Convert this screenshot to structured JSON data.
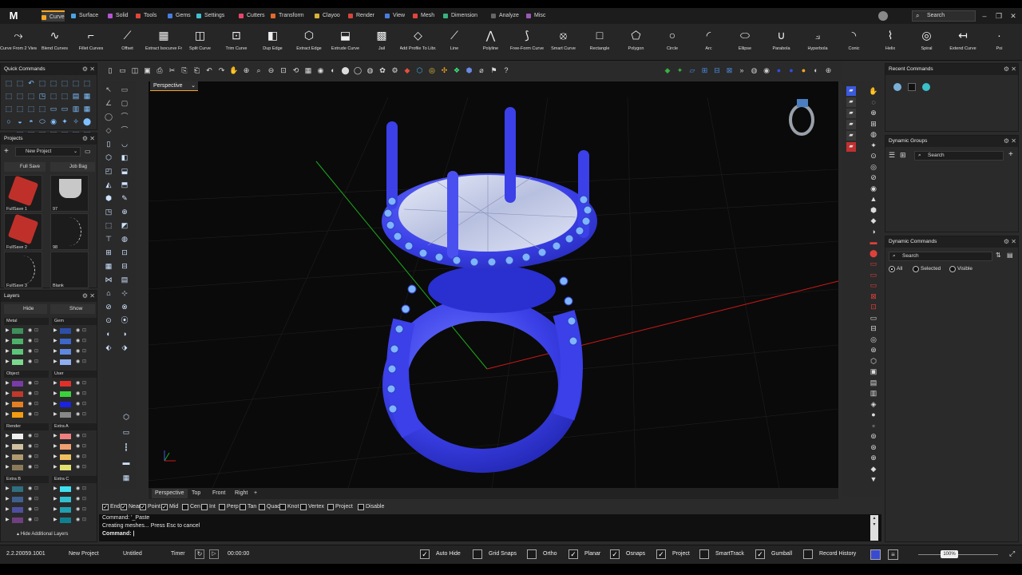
{
  "app": {
    "logo": "M",
    "search_placeholder": "Search"
  },
  "tabs": [
    {
      "label": "Curve",
      "color": "#f5a623"
    },
    {
      "label": "Surface",
      "color": "#4aa3df"
    },
    {
      "label": "Solid",
      "color": "#b455d6"
    },
    {
      "label": "Tools",
      "color": "#e0453a"
    },
    {
      "label": "Gems",
      "color": "#4a7be0"
    },
    {
      "label": "Settings",
      "color": "#3ec1d3"
    },
    {
      "label": "Cutters",
      "color": "#e8456a"
    },
    {
      "label": "Transform",
      "color": "#e06a2c"
    },
    {
      "label": "Clayoo",
      "color": "#d6b13c"
    },
    {
      "label": "Render",
      "color": "#d6453a"
    },
    {
      "label": "View",
      "color": "#4a7be0"
    },
    {
      "label": "Mesh",
      "color": "#e0453a"
    },
    {
      "label": "Dimension",
      "color": "#36b37e"
    },
    {
      "label": "Analyze",
      "color": "#666666"
    },
    {
      "label": "Misc",
      "color": "#9b59b6"
    }
  ],
  "ribbon": [
    {
      "label": "Curve From 2 Views",
      "icon": "curve-from-views-icon",
      "glyph": "⤳"
    },
    {
      "label": "Blend Curves",
      "icon": "blend-curves-icon",
      "glyph": "∿"
    },
    {
      "label": "Fillet Curves",
      "icon": "fillet-curves-icon",
      "glyph": "⌐"
    },
    {
      "label": "Offset",
      "icon": "offset-icon",
      "glyph": "⟋"
    },
    {
      "label": "Extract Isocurve Fr...",
      "icon": "extract-isocurve-icon",
      "glyph": "▦"
    },
    {
      "label": "Split Curve",
      "icon": "split-curve-icon",
      "glyph": "◫"
    },
    {
      "label": "Trim Curve",
      "icon": "trim-curve-icon",
      "glyph": "⊡"
    },
    {
      "label": "Dup Edge",
      "icon": "dup-edge-icon",
      "glyph": "◧"
    },
    {
      "label": "Extract Edge",
      "icon": "extract-edge-icon",
      "glyph": "⬡"
    },
    {
      "label": "Extrude Curve",
      "icon": "extrude-curve-icon",
      "glyph": "⬓"
    },
    {
      "label": "Jail",
      "icon": "jail-icon",
      "glyph": "▩"
    },
    {
      "label": "Add Profile To Libr...",
      "icon": "add-profile-icon",
      "glyph": "◇"
    },
    {
      "label": "Line",
      "icon": "line-icon",
      "glyph": "⟋"
    },
    {
      "label": "Polyline",
      "icon": "polyline-icon",
      "glyph": "⋀"
    },
    {
      "label": "Free-Form Curve",
      "icon": "freeform-curve-icon",
      "glyph": "⟆"
    },
    {
      "label": "Smart Curve",
      "icon": "smart-curve-icon",
      "glyph": "⦻"
    },
    {
      "label": "Rectangle",
      "icon": "rectangle-icon",
      "glyph": "□"
    },
    {
      "label": "Polygon",
      "icon": "polygon-icon",
      "glyph": "⬠"
    },
    {
      "label": "Circle",
      "icon": "circle-icon",
      "glyph": "○"
    },
    {
      "label": "Arc",
      "icon": "arc-icon",
      "glyph": "◜"
    },
    {
      "label": "Ellipse",
      "icon": "ellipse-icon",
      "glyph": "⬭"
    },
    {
      "label": "Parabola",
      "icon": "parabola-icon",
      "glyph": "∪"
    },
    {
      "label": "Hyperbola",
      "icon": "hyperbola-icon",
      "glyph": "⟓"
    },
    {
      "label": "Conic",
      "icon": "conic-icon",
      "glyph": "◝"
    },
    {
      "label": "Helix",
      "icon": "helix-icon",
      "glyph": "⌇"
    },
    {
      "label": "Spiral",
      "icon": "spiral-icon",
      "glyph": "◎"
    },
    {
      "label": "Extend Curve",
      "icon": "extend-curve-icon",
      "glyph": "↤"
    },
    {
      "label": "Poi",
      "icon": "point-icon",
      "glyph": "·"
    }
  ],
  "quick_commands": {
    "title": "Quick Commands"
  },
  "projects": {
    "title": "Projects",
    "new_project": "New Project",
    "full_save": "Full Save",
    "job_bag": "Job Bag",
    "items": [
      {
        "label": "FullSave 1"
      },
      {
        "label": "97"
      },
      {
        "label": "FullSave 2"
      },
      {
        "label": "98"
      },
      {
        "label": "FullSave 3"
      },
      {
        "label": "Blank"
      }
    ]
  },
  "layers": {
    "title": "Layers",
    "hide": "Hide",
    "show": "Show",
    "hide_additional": "Hide Additional Layers",
    "groups": [
      {
        "name": "Metal",
        "colors": [
          "#3f8f5a",
          "#4db06b",
          "#5cc57a",
          "#7bd88f"
        ]
      },
      {
        "name": "Gem",
        "colors": [
          "#2d4fa8",
          "#3d67c8",
          "#5f88e0",
          "#8fb0f0"
        ]
      },
      {
        "name": "Object",
        "colors": [
          "#7a3aa8",
          "#c0392b",
          "#e67e22",
          "#f39c12"
        ]
      },
      {
        "name": "User",
        "colors": [
          "#e0302a",
          "#3bd13b",
          "#1b22e0",
          "#888888"
        ]
      },
      {
        "name": "Render",
        "colors": [
          "#f0f0f0",
          "#cfc0a0",
          "#b09a70",
          "#8a7a5a"
        ]
      },
      {
        "name": "Extra A",
        "colors": [
          "#f08080",
          "#f0a070",
          "#f0c060",
          "#e0e070"
        ]
      },
      {
        "name": "Extra B",
        "colors": [
          "#2f6f7f",
          "#3f5f8f",
          "#4f4f9f",
          "#6f3f7f"
        ]
      },
      {
        "name": "Extra C",
        "colors": [
          "#40e0f0",
          "#30c0d0",
          "#20a0b0",
          "#108090"
        ]
      }
    ]
  },
  "viewport": {
    "label": "Perspective",
    "tabs": [
      "Perspective",
      "Top",
      "Front",
      "Right"
    ],
    "add_tab": "+"
  },
  "snaps": [
    {
      "label": "End",
      "checked": true
    },
    {
      "label": "Near",
      "checked": true
    },
    {
      "label": "Point",
      "checked": true
    },
    {
      "label": "Mid",
      "checked": true
    },
    {
      "label": "Cen",
      "checked": false
    },
    {
      "label": "Int",
      "checked": false
    },
    {
      "label": "Perp",
      "checked": false
    },
    {
      "label": "Tan",
      "checked": false
    },
    {
      "label": "Quad",
      "checked": false
    },
    {
      "label": "Knot",
      "checked": false
    },
    {
      "label": "Vertex",
      "checked": false
    },
    {
      "label": "Project",
      "checked": false
    },
    {
      "label": "Disable",
      "checked": false
    }
  ],
  "command": {
    "line1": "Command: '_Paste",
    "line2": "Creating meshes... Press Esc to cancel",
    "prompt": "Command:"
  },
  "status": {
    "version": "2.2.20059.1001",
    "project": "New Project",
    "file": "Untitled",
    "timer_label": "Timer",
    "timer": "00:00:00",
    "toggles": [
      {
        "label": "Auto Hide",
        "checked": true
      },
      {
        "label": "Grid Snaps",
        "checked": false
      },
      {
        "label": "Ortho",
        "checked": false
      },
      {
        "label": "Planar",
        "checked": true
      },
      {
        "label": "Osnaps",
        "checked": true
      },
      {
        "label": "Project",
        "checked": true
      },
      {
        "label": "SmartTrack",
        "checked": false
      },
      {
        "label": "Gumball",
        "checked": true
      },
      {
        "label": "Record History",
        "checked": false
      }
    ],
    "zoom": "100%"
  },
  "right_panels": {
    "recent": {
      "title": "Recent Commands"
    },
    "groups": {
      "title": "Dynamic Groups",
      "search": "Search"
    },
    "dyn_commands": {
      "title": "Dynamic Commands",
      "search": "Search",
      "filters": [
        {
          "label": "All",
          "selected": true
        },
        {
          "label": "Selected",
          "selected": false
        },
        {
          "label": "Visible",
          "selected": false
        }
      ]
    }
  }
}
